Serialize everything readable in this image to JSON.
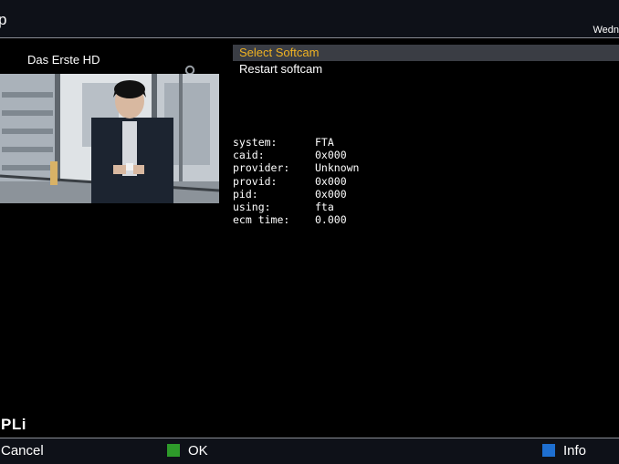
{
  "header": {
    "title": "p",
    "clock": "Wedn"
  },
  "preview": {
    "channel_name": "Das Erste HD"
  },
  "menu": {
    "items": [
      {
        "label": "Select Softcam",
        "selected": true
      },
      {
        "label": "Restart softcam",
        "selected": false
      }
    ]
  },
  "info": {
    "rows": [
      {
        "key": "system:",
        "value": "FTA"
      },
      {
        "key": "caid:",
        "value": "0x000"
      },
      {
        "key": "provider:",
        "value": "Unknown"
      },
      {
        "key": "provid:",
        "value": "0x000"
      },
      {
        "key": "pid:",
        "value": "0x000"
      },
      {
        "key": "using:",
        "value": "fta"
      },
      {
        "key": "ecm time:",
        "value": "0.000"
      }
    ]
  },
  "logo": "PLi",
  "footer": {
    "cancel_label": "Cancel",
    "ok_label": "OK",
    "info_label": "Info"
  },
  "colors": {
    "selection_text": "#f0b323",
    "selection_bg": "#3a3d44",
    "green_key": "#2e9a2a",
    "blue_key": "#1e6fd0"
  },
  "icons": {
    "record": "record-icon",
    "green": "green-key-icon",
    "blue": "blue-key-icon"
  }
}
